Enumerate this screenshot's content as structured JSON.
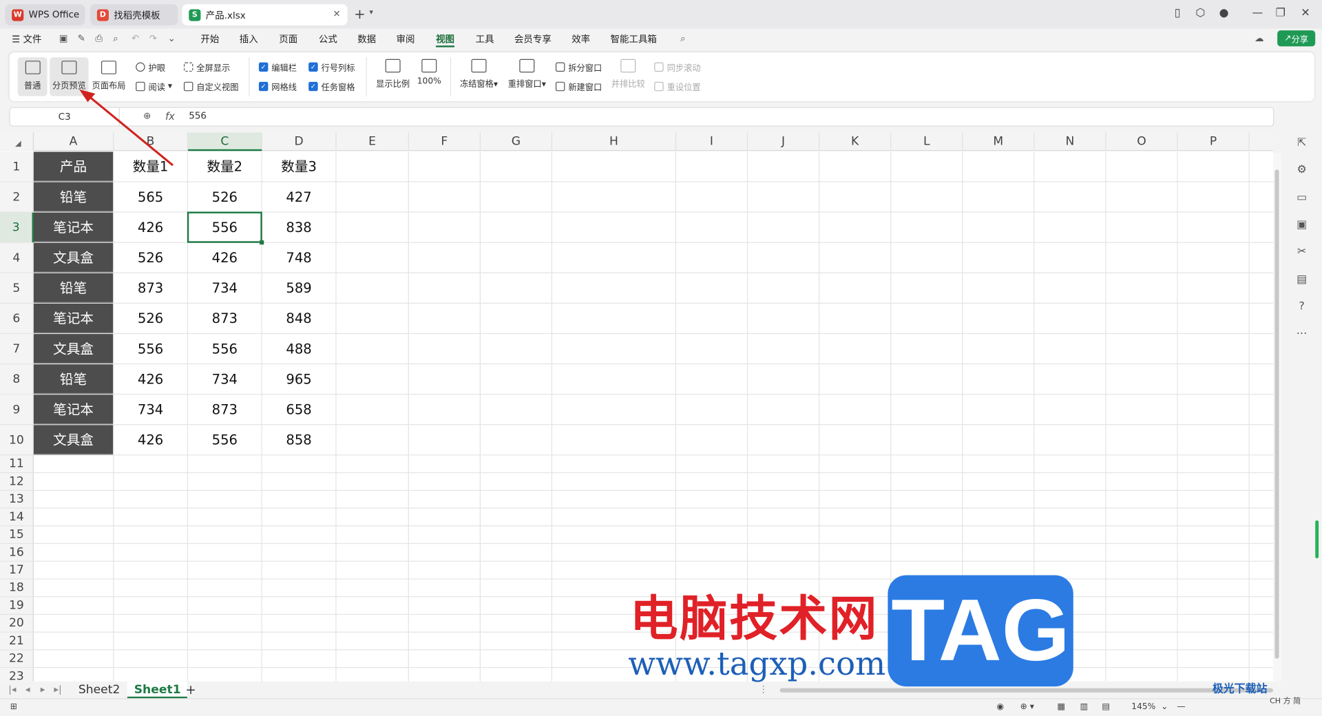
{
  "tabs": [
    {
      "label": "WPS Office",
      "icon": "wps-logo-icon"
    },
    {
      "label": "找稻壳模板",
      "icon": "docer-icon"
    },
    {
      "label": "产品.xlsx",
      "icon": "spreadsheet-icon"
    }
  ],
  "menu": {
    "file": "文件",
    "items": [
      "开始",
      "插入",
      "页面",
      "公式",
      "数据",
      "审阅",
      "视图",
      "工具",
      "会员专享",
      "效率",
      "智能工具箱"
    ],
    "active": "视图",
    "share": "分享"
  },
  "ribbon": {
    "normal": "普通",
    "page_break_preview": "分页预览",
    "page_layout": "页面布局",
    "eye_care": "护眼",
    "reading": "阅读",
    "full_screen": "全屏显示",
    "custom_view": "自定义视图",
    "edit_bar": "编辑栏",
    "row_col_headers": "行号列标",
    "gridlines": "网格线",
    "task_pane": "任务窗格",
    "zoom": "显示比例",
    "zoom_100": "100%",
    "freeze": "冻结窗格",
    "rearrange": "重排窗口",
    "split": "拆分窗口",
    "new_window": "新建窗口",
    "side_by_side": "并排比较",
    "sync_scroll": "同步滚动",
    "reset_position": "重设位置"
  },
  "formula_bar": {
    "name_box": "C3",
    "fx": "fx",
    "value": "556"
  },
  "columns": [
    "A",
    "B",
    "C",
    "D",
    "E",
    "F",
    "G",
    "H",
    "I",
    "J",
    "K",
    "L",
    "M",
    "N",
    "O",
    "P"
  ],
  "selected_column": "C",
  "rows": [
    "1",
    "2",
    "3",
    "4",
    "5",
    "6",
    "7",
    "8",
    "9",
    "10",
    "11",
    "12",
    "13",
    "14",
    "15",
    "16",
    "17",
    "18",
    "19",
    "20",
    "21",
    "22",
    "23"
  ],
  "selected_row": "3",
  "table": {
    "headers": [
      "产品",
      "数量1",
      "数量2",
      "数量3"
    ],
    "data": [
      [
        "铅笔",
        "565",
        "526",
        "427"
      ],
      [
        "笔记本",
        "426",
        "556",
        "838"
      ],
      [
        "文具盒",
        "526",
        "426",
        "748"
      ],
      [
        "铅笔",
        "873",
        "734",
        "589"
      ],
      [
        "笔记本",
        "526",
        "873",
        "848"
      ],
      [
        "文具盒",
        "556",
        "556",
        "488"
      ],
      [
        "铅笔",
        "426",
        "734",
        "965"
      ],
      [
        "笔记本",
        "734",
        "873",
        "658"
      ],
      [
        "文具盒",
        "426",
        "556",
        "858"
      ]
    ]
  },
  "sheets": [
    "Sheet2",
    "Sheet1"
  ],
  "active_sheet": "Sheet1",
  "status": {
    "zoom": "145%",
    "ime": "CH ⽅ 简"
  },
  "watermark": {
    "cn": "电脑技术网",
    "url": "www.tagxp.com",
    "tag": "TAG",
    "corner": "极光下载站"
  },
  "colors": {
    "accent": "#1d7a45",
    "product_fill": "#4d4d4d",
    "share": "#1f9a55",
    "arrow": "#d0231f"
  }
}
